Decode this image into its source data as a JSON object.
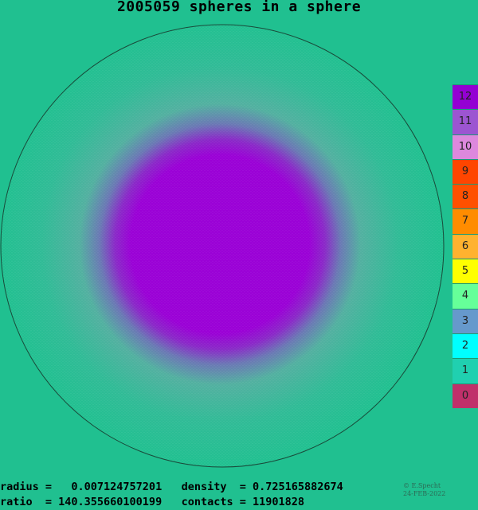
{
  "title": "2005059 spheres in a sphere",
  "colors": {
    "background": "#20c090",
    "outer_shell": "#20c090",
    "mid_shell": "#52b0a0",
    "core": "#9a00d6"
  },
  "legend": {
    "items": [
      {
        "label": "12",
        "color": "#9400d3"
      },
      {
        "label": "11",
        "color": "#9c55d1"
      },
      {
        "label": "10",
        "color": "#dd88dd"
      },
      {
        "label": "9",
        "color": "#ff4500"
      },
      {
        "label": "8",
        "color": "#ff5000"
      },
      {
        "label": "7",
        "color": "#ff8c00"
      },
      {
        "label": "6",
        "color": "#ffb22f"
      },
      {
        "label": "5",
        "color": "#ffff00"
      },
      {
        "label": "4",
        "color": "#66ff99"
      },
      {
        "label": "3",
        "color": "#6699cc"
      },
      {
        "label": "2",
        "color": "#00ffff"
      },
      {
        "label": "1",
        "color": "#20d0b0"
      },
      {
        "label": "0",
        "color": "#c0306a"
      }
    ]
  },
  "stats": {
    "line1": "radius =   0.007124757201   density  = 0.725165882674",
    "line2": "ratio  = 140.355660100199   contacts = 11901828"
  },
  "credit": {
    "author": "© E.Specht",
    "date": "24-FEB-2022"
  }
}
